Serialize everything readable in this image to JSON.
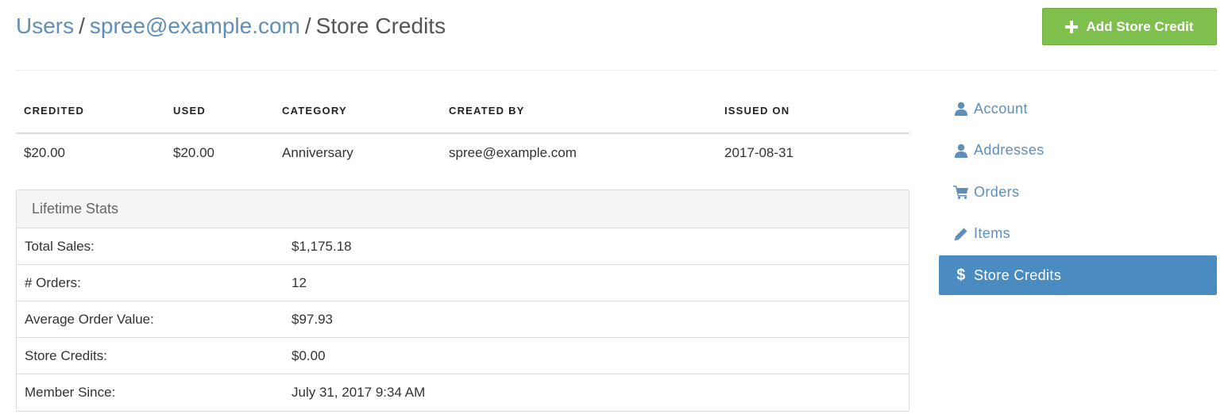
{
  "header": {
    "breadcrumb": {
      "users": "Users",
      "email": "spree@example.com",
      "current": "Store Credits",
      "separator": "/"
    },
    "add_button_label": "Add Store Credit"
  },
  "credits_table": {
    "columns": [
      "CREDITED",
      "USED",
      "CATEGORY",
      "CREATED BY",
      "ISSUED ON"
    ],
    "rows": [
      [
        "$20.00",
        "$20.00",
        "Anniversary",
        "spree@example.com",
        "2017-08-31"
      ]
    ]
  },
  "lifetime_stats": {
    "heading": "Lifetime Stats",
    "rows": [
      {
        "label": "Total Sales:",
        "value": "$1,175.18"
      },
      {
        "label": "# Orders:",
        "value": "12"
      },
      {
        "label": "Average Order Value:",
        "value": "$97.93"
      },
      {
        "label": "Store Credits:",
        "value": "$0.00"
      },
      {
        "label": "Member Since:",
        "value": "July 31, 2017 9:34 AM"
      }
    ]
  },
  "side_nav": {
    "items": [
      {
        "label": "Account",
        "icon": "user-icon"
      },
      {
        "label": "Addresses",
        "icon": "user-icon"
      },
      {
        "label": "Orders",
        "icon": "cart-icon"
      },
      {
        "label": "Items",
        "icon": "pencil-icon"
      },
      {
        "label": "Store Credits",
        "icon": "dollar-icon",
        "active": true
      }
    ]
  },
  "colors": {
    "link": "#5f8fb9",
    "add_button": "#7fbf4d",
    "active_nav": "#4a8bc2"
  }
}
